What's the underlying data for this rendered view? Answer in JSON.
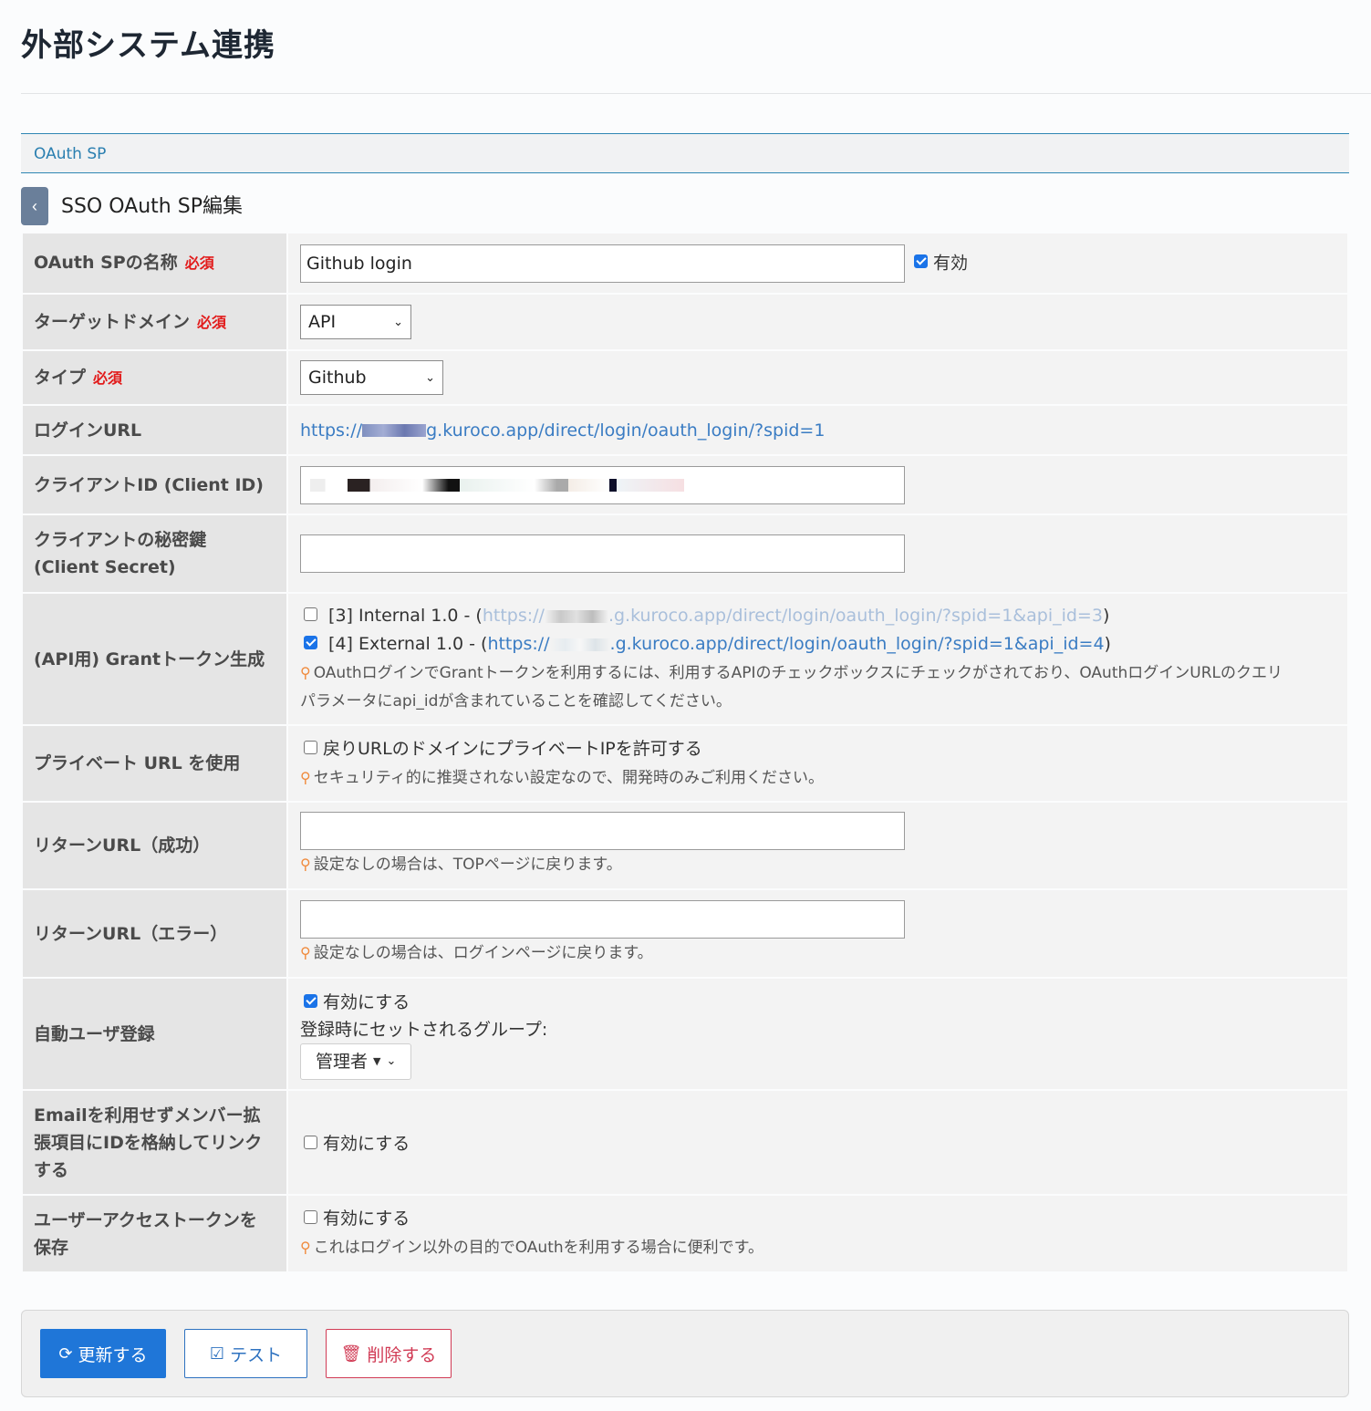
{
  "page": {
    "title": "外部システム連携",
    "section": "OAuth SP",
    "subtitle": "SSO OAuth SP編集",
    "back_icon": "chevron-left-icon"
  },
  "required_label": "必須",
  "form": {
    "name": {
      "label": "OAuth SPの名称",
      "value": "Github login",
      "enabled_label": "有効",
      "enabled": true
    },
    "target_domain": {
      "label": "ターゲットドメイン",
      "value": "API"
    },
    "type": {
      "label": "タイプ",
      "value": "Github"
    },
    "login_url": {
      "label": "ログインURL",
      "prefix": "https://",
      "suffix": "g.kuroco.app/direct/login/oauth_login/?spid=1"
    },
    "client_id": {
      "label": "クライアントID (Client ID)"
    },
    "client_secret": {
      "label": "クライアントの秘密鍵",
      "label2": "(Client Secret)",
      "value": ""
    },
    "grant_token": {
      "label": "(API用) Grantトークン生成",
      "items": [
        {
          "prefix": "[3] Internal 1.0 - (",
          "url_start": "https://",
          "url_end": ".g.kuroco.app/direct/login/oauth_login/?spid=1&api_id=3",
          "close": ")",
          "checked": false
        },
        {
          "prefix": "[4] External 1.0 - (",
          "url_start": "https://",
          "url_end": ".g.kuroco.app/direct/login/oauth_login/?spid=1&api_id=4",
          "close": ")",
          "checked": true
        }
      ],
      "hint_line1": "OAuthログインでGrantトークンを利用するには、利用するAPIのチェックボックスにチェックがされており、OAuthログインURLのクエリ",
      "hint_line2": "パラメータにapi_idが含まれていることを確認してください。"
    },
    "private_url": {
      "label": "プライベート URL を使用",
      "checkbox_label": "戻りURLのドメインにプライベートIPを許可する",
      "checked": false,
      "hint": "セキュリティ的に推奨されない設定なので、開発時のみご利用ください。"
    },
    "return_success": {
      "label": "リターンURL（成功）",
      "value": "",
      "hint": "設定なしの場合は、TOPページに戻ります。"
    },
    "return_error": {
      "label": "リターンURL（エラー）",
      "value": "",
      "hint": "設定なしの場合は、ログインページに戻ります。"
    },
    "auto_register": {
      "label": "自動ユーザ登録",
      "checkbox_label": "有効にする",
      "checked": true,
      "group_label": "登録時にセットされるグループ:",
      "group_value": "管理者"
    },
    "link_by_id": {
      "label_line1": "Emailを利用せずメンバー拡",
      "label_line2": "張項目にIDを格納してリンク",
      "label_line3": "する",
      "checkbox_label": "有効にする",
      "checked": false
    },
    "save_token": {
      "label_line1": "ユーザーアクセストークンを",
      "label_line2": "保存",
      "checkbox_label": "有効にする",
      "checked": false,
      "hint": "これはログイン以外の目的でOAuthを利用する場合に便利です。"
    }
  },
  "buttons": {
    "update": "更新する",
    "test": "テスト",
    "delete": "削除する"
  },
  "colors": {
    "primary": "#1f76d8",
    "danger": "#d13b55",
    "required": "#e21b1b",
    "link": "#3a7cc3"
  }
}
